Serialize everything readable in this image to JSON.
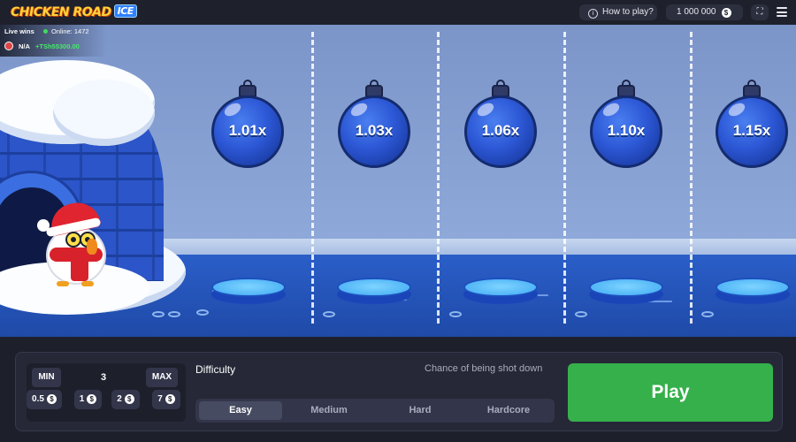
{
  "topbar": {
    "logo_main": "CHICKEN ROAD",
    "logo_sub": "ICE",
    "how_to_play": "How to play?",
    "balance": "1 000 000",
    "currency_symbol": "$"
  },
  "live": {
    "title": "Live wins",
    "online": "Online: 1472",
    "player": "N/A",
    "win": "+TSh55300.00"
  },
  "lanes": [
    {
      "multiplier": "1.01x"
    },
    {
      "multiplier": "1.03x"
    },
    {
      "multiplier": "1.06x"
    },
    {
      "multiplier": "1.10x"
    },
    {
      "multiplier": "1.15x"
    }
  ],
  "controls": {
    "min_label": "MIN",
    "max_label": "MAX",
    "bet_value": "3",
    "quick_bets": [
      {
        "value": "0.5",
        "icon": "$"
      },
      {
        "value": "1",
        "icon": "$"
      },
      {
        "value": "2",
        "icon": "$"
      },
      {
        "value": "7",
        "icon": "$"
      }
    ],
    "difficulty_label": "Difficulty",
    "chance_label": "Chance of being shot down",
    "difficulties": [
      "Easy",
      "Medium",
      "Hard",
      "Hardcore"
    ],
    "selected_difficulty": "Easy",
    "play_label": "Play"
  },
  "colors": {
    "play_green": "#36b04b",
    "win_green": "#48e86b",
    "ornament_blue": "#2d58d6"
  }
}
